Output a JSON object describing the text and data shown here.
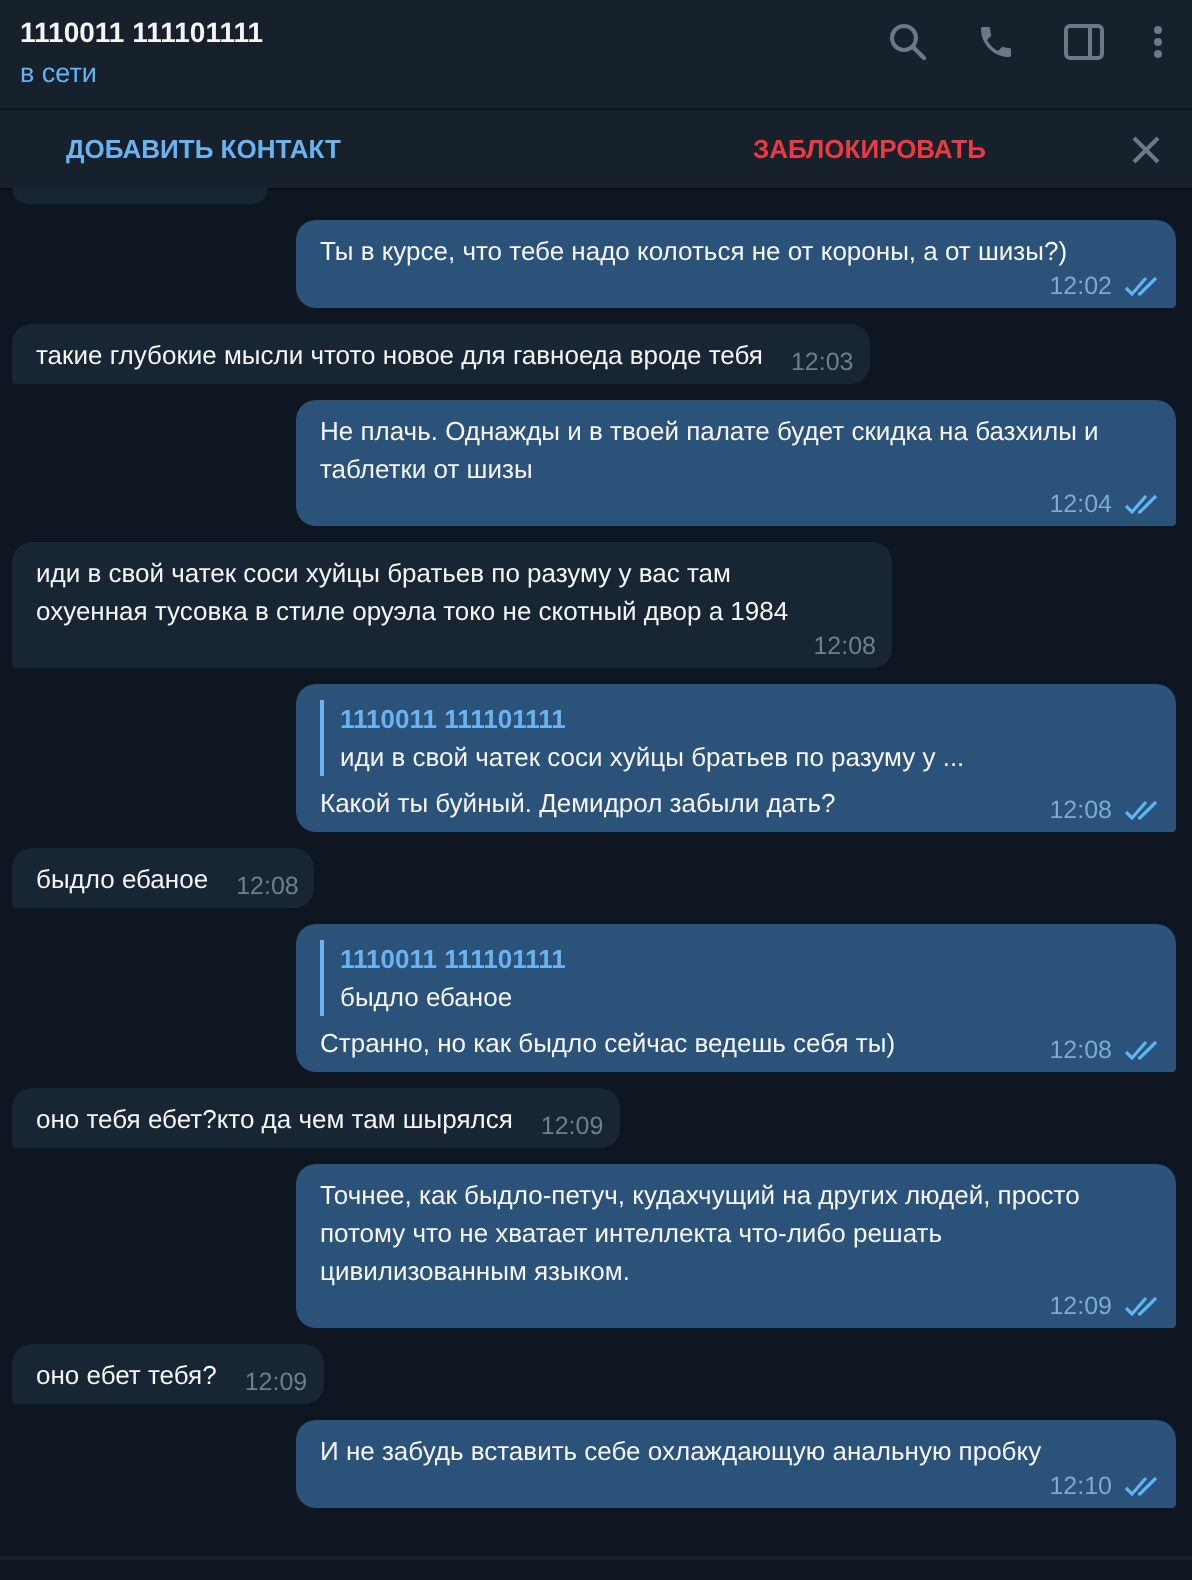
{
  "header": {
    "title": "1110011 111101111",
    "status": "в сети"
  },
  "action_bar": {
    "add": "ДОБАВИТЬ КОНТАКТ",
    "block": "ЗАБЛОКИРОВАТЬ"
  },
  "messages": [
    {
      "kind": "cut",
      "out": false
    },
    {
      "kind": "text",
      "out": true,
      "text": "Ты в курсе, что тебе надо колоться не от короны, а от шизы?)",
      "time": "12:02",
      "read": true
    },
    {
      "kind": "text",
      "out": false,
      "text": "такие глубокие мысли чтото новое для гавноеда вроде тебя",
      "time": "12:03"
    },
    {
      "kind": "text",
      "out": true,
      "text": "Не плачь. Однажды и в твоей палате будет скидка на базхилы и\nтаблетки от шизы",
      "time": "12:04",
      "read": true
    },
    {
      "kind": "text",
      "out": false,
      "text": "иди в свой чатек соси хуйцы братьев по разуму у вас там\nохуенная тусовка в стиле оруэла токо не скотный двор а 1984",
      "time": "12:08"
    },
    {
      "kind": "text",
      "out": true,
      "reply": {
        "author": "1110011 111101111",
        "text": "иди в свой чатек соси хуйцы братьев по разуму у ..."
      },
      "text": "Какой ты буйный. Демидрол забыли дать?",
      "time": "12:08",
      "read": true
    },
    {
      "kind": "text",
      "out": false,
      "text": "быдло ебаное",
      "time": "12:08"
    },
    {
      "kind": "text",
      "out": true,
      "reply": {
        "author": "1110011 111101111",
        "text": "быдло ебаное"
      },
      "text": "Странно, но как быдло сейчас ведешь себя ты)",
      "time": "12:08",
      "read": true
    },
    {
      "kind": "text",
      "out": false,
      "text": "оно тебя ебет?кто да чем там шырялся",
      "time": "12:09"
    },
    {
      "kind": "text",
      "out": true,
      "text": "Точнее, как быдло-петуч, кудахчущий на других людей, просто\nпотому что не хватает интеллекта что-либо решать\nцивилизованным языком.",
      "time": "12:09",
      "read": true
    },
    {
      "kind": "text",
      "out": false,
      "text": "оно ебет тебя?",
      "time": "12:09"
    },
    {
      "kind": "text",
      "out": true,
      "text": "И не забудь вставить себе охлаждающую анальную пробку",
      "time": "12:10",
      "read": true
    }
  ]
}
